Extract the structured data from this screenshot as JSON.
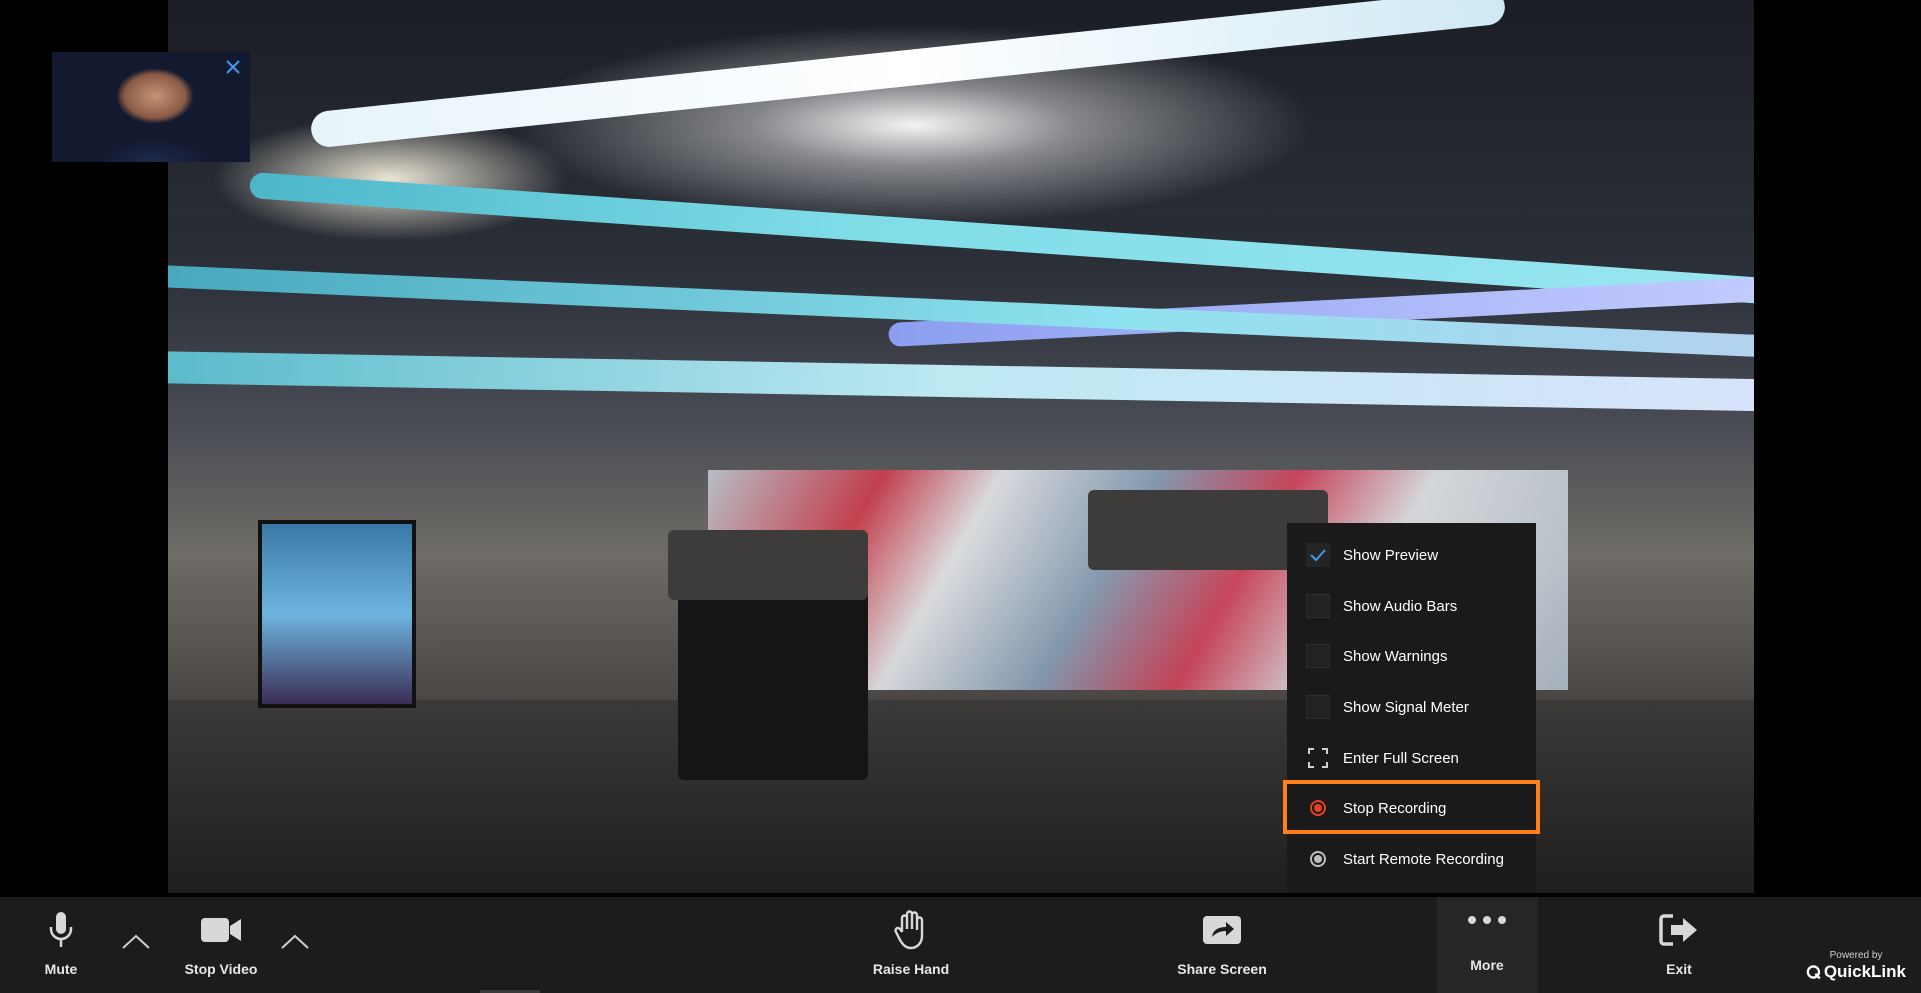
{
  "context_menu": {
    "items": [
      {
        "label": "Show Preview",
        "icon": "checkbox-checked"
      },
      {
        "label": "Show Audio Bars",
        "icon": "checkbox-empty"
      },
      {
        "label": "Show Warnings",
        "icon": "checkbox-empty"
      },
      {
        "label": "Show Signal Meter",
        "icon": "checkbox-empty"
      },
      {
        "label": "Enter Full Screen",
        "icon": "fullscreen-icon"
      },
      {
        "label": "Stop Recording",
        "icon": "record-active-icon"
      },
      {
        "label": "Start Remote Recording",
        "icon": "record-inactive-icon"
      }
    ],
    "highlighted_item": "Stop Recording"
  },
  "toolbar": {
    "mute_label": "Mute",
    "stop_video_label": "Stop Video",
    "raise_hand_label": "Raise Hand",
    "share_screen_label": "Share Screen",
    "more_label": "More",
    "exit_label": "Exit"
  },
  "branding": {
    "powered_by": "Powered by",
    "name": "QuickLink"
  },
  "colors": {
    "accent_orange": "#ff7f1a",
    "record_red": "#e8421a",
    "check_blue": "#3d9be9",
    "toolbar_bg": "#1c1c1c",
    "menu_bg": "#1a1a1a"
  }
}
